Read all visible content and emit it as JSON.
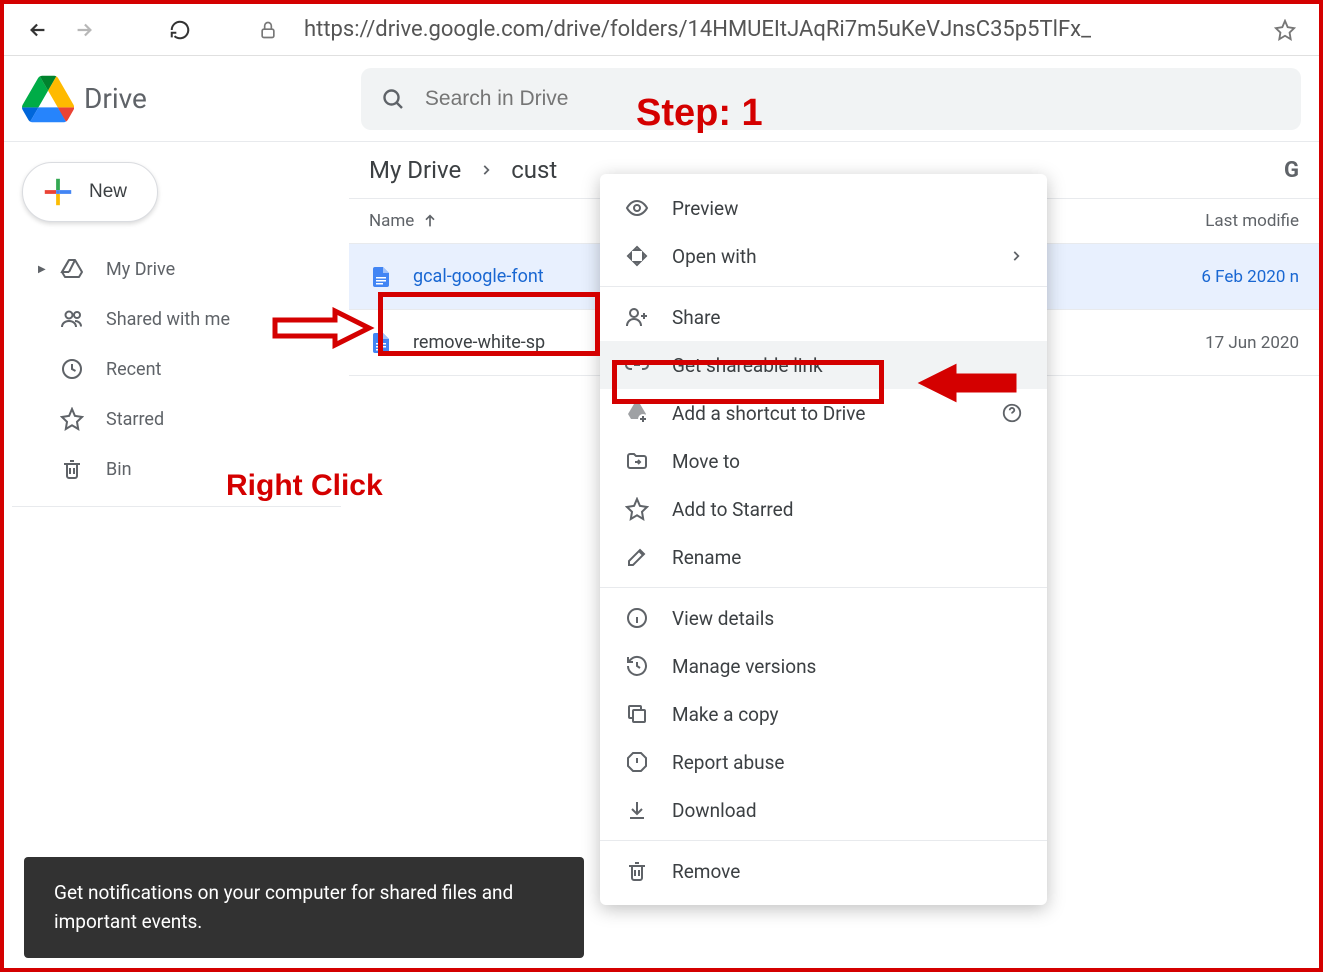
{
  "browser": {
    "url": "https://drive.google.com/drive/folders/14HMUEItJAqRi7m5uKeVJnsC35p5TlFx_"
  },
  "header": {
    "app_name": "Drive",
    "search_placeholder": "Search in Drive"
  },
  "sidebar": {
    "new_label": "New",
    "items": [
      {
        "label": "My Drive"
      },
      {
        "label": "Shared with me"
      },
      {
        "label": "Recent"
      },
      {
        "label": "Starred"
      },
      {
        "label": "Bin"
      }
    ]
  },
  "breadcrumb": {
    "root": "My Drive",
    "current": "cust"
  },
  "columns": {
    "name": "Name",
    "modified": "Last modifie"
  },
  "files": [
    {
      "name": "gcal-google-font",
      "date": "6 Feb 2020 n"
    },
    {
      "name": "remove-white-sp",
      "date": "17 Jun 2020"
    }
  ],
  "context_menu": {
    "items": [
      {
        "label": "Preview"
      },
      {
        "label": "Open with"
      },
      {
        "label": "Share"
      },
      {
        "label": "Get shareable link"
      },
      {
        "label": "Add a shortcut to Drive"
      },
      {
        "label": "Move to"
      },
      {
        "label": "Add to Starred"
      },
      {
        "label": "Rename"
      },
      {
        "label": "View details"
      },
      {
        "label": "Manage versions"
      },
      {
        "label": "Make a copy"
      },
      {
        "label": "Report abuse"
      },
      {
        "label": "Download"
      },
      {
        "label": "Remove"
      }
    ]
  },
  "toast": {
    "text": "Get notifications on your computer for shared files and important events."
  },
  "annotations": {
    "step": "Step: 1",
    "right_click": "Right Click"
  }
}
